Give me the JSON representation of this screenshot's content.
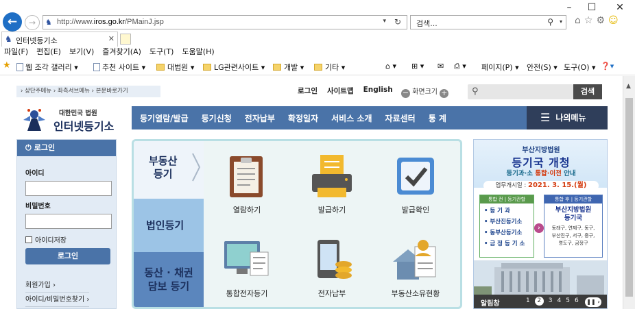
{
  "browser": {
    "url_prefix": "http://www.",
    "url_domain": "iros.go.kr",
    "url_path": "/PMainJ.jsp",
    "search_placeholder": "검색...",
    "tab_title": "인터넷등기소",
    "menu": [
      "파일(F)",
      "편집(E)",
      "보기(V)",
      "즐겨찾기(A)",
      "도구(T)",
      "도움말(H)"
    ],
    "favorites": {
      "gallery": "웹 조각 갤러리 ▾",
      "suggested": "추천 사이트 ▾",
      "court": "대법원 ▾",
      "lg": "LG관련사이트 ▾",
      "dev": "개발 ▾",
      "etc": "기타 ▾",
      "page": "페이지(P) ▾",
      "safety": "안전(S) ▾",
      "tools": "도구(O) ▾"
    }
  },
  "site": {
    "skip_links": "› 상단주메뉴 › 좌측서브메뉴 › 본문바로가기",
    "util": {
      "login": "로그인",
      "sitemap": "사이트맵",
      "english": "English",
      "zoom": "화면크기"
    },
    "search_button": "검색",
    "logo_small": "대한민국 법원",
    "logo_big": "인터넷등기소",
    "gnb": [
      "등기열람/발급",
      "등기신청",
      "전자납부",
      "확정일자",
      "서비스 소개",
      "자료센터",
      "통 계"
    ],
    "my_menu": "나의메뉴",
    "login": {
      "title": "로그인",
      "id_label": "아이디",
      "pw_label": "비밀번호",
      "save_id": "아이디저장",
      "button": "로그인",
      "join": "회원가입 ›",
      "find": "아이디/비밀번호찾기 ›"
    },
    "categories": {
      "realestate_1": "부동산",
      "realestate_2": "등기",
      "corporate": "법인등기",
      "movable_1": "동산 · 채권",
      "movable_2": "담보 등기"
    },
    "services": {
      "view": "열람하기",
      "issue": "발급하기",
      "verify": "발급확인",
      "integrated": "통합전자등기",
      "payment": "전자납부",
      "ownership": "부동산소유현황"
    },
    "banner": {
      "small": "부산지방법원",
      "big": "등기국 개청",
      "sub_a": "등기과·소 ",
      "sub_b": "통합·이전",
      "sub_c": " 안내",
      "date_label": "업무개시일 : ",
      "date": "2021. 3. 15.(월)",
      "box1_head": "통합 전 | 등기관할",
      "box1_rows": [
        "• 등   기   과",
        "• 부산진등기소",
        "• 동부산등기소",
        "• 금 정 등 기 소"
      ],
      "box2_head": "통합 후 | 등기관할",
      "box2_title_1": "부산지방법원",
      "box2_title_2": "등기국",
      "box2_text_1": "동래구, 연제구, 동구,",
      "box2_text_2": "부산진구, 서구, 중구,",
      "box2_text_3": "영도구, 금정구",
      "notice": "알림창",
      "pages": [
        "1",
        "2",
        "3",
        "4",
        "5",
        "6"
      ]
    }
  }
}
